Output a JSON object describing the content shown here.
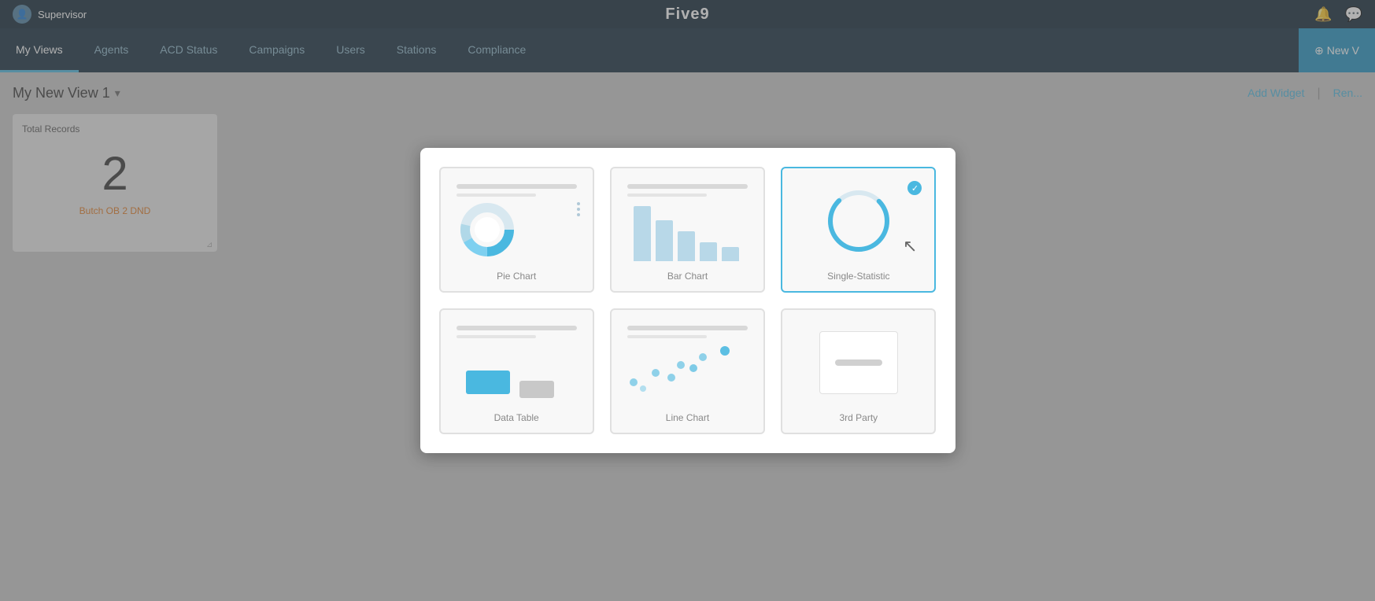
{
  "app": {
    "logo": "Five9",
    "user": "Supervisor"
  },
  "topbar": {
    "notification_icon": "🔔",
    "chat_icon": "💬"
  },
  "navbar": {
    "items": [
      {
        "label": "My Views",
        "active": true
      },
      {
        "label": "Agents",
        "active": false
      },
      {
        "label": "ACD Status",
        "active": false
      },
      {
        "label": "Campaigns",
        "active": false
      },
      {
        "label": "Users",
        "active": false
      },
      {
        "label": "Stations",
        "active": false
      },
      {
        "label": "Compliance",
        "active": false
      }
    ],
    "new_button": "⊕ New V"
  },
  "page": {
    "title": "My New View 1",
    "add_widget_label": "Add Widget",
    "rename_label": "Ren..."
  },
  "widget": {
    "title": "Total Records",
    "value": "2",
    "subtitle": "Butch OB 2 DND"
  },
  "modal": {
    "options": [
      {
        "id": "pie-chart",
        "label": "Pie Chart",
        "selected": false
      },
      {
        "id": "bar-chart",
        "label": "Bar Chart",
        "selected": false
      },
      {
        "id": "single-statistic",
        "label": "Single-Statistic",
        "selected": true
      },
      {
        "id": "data-table",
        "label": "Data Table",
        "selected": false
      },
      {
        "id": "line-chart",
        "label": "Line Chart",
        "selected": false
      },
      {
        "id": "3rd-party",
        "label": "3rd Party",
        "selected": false
      }
    ]
  }
}
